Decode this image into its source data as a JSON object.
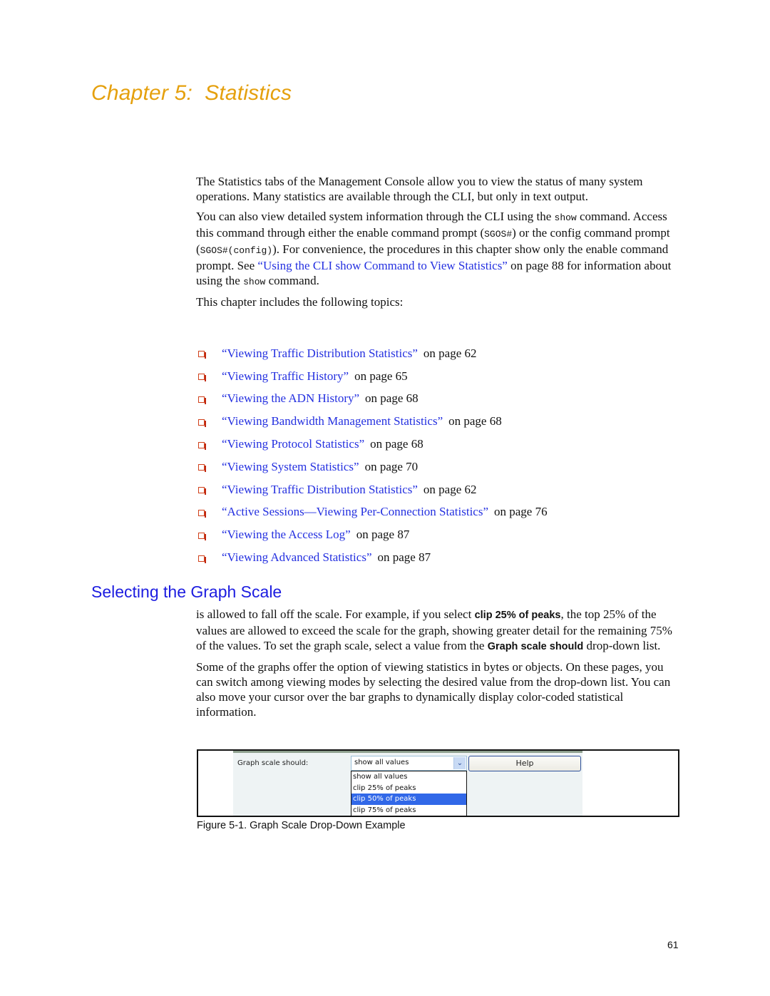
{
  "chapter": {
    "title": "Chapter 5:  Statistics"
  },
  "intro": {
    "p1": "The Statistics tabs of the Management Console allow you to view the status of many system operations. Many statistics are available through the CLI, but only in text output.",
    "p2": {
      "t1": "You can also view detailed system information through the CLI using the ",
      "code1": "show",
      "t2": " command. Access this command through either the enable command prompt (",
      "code2": "SGOS#",
      "t3": ") or the config command prompt (",
      "code3": "SGOS#(config)",
      "t4": "). For convenience, the procedures in this chapter show only the enable command prompt. See ",
      "link": "“Using the CLI show Command to View Statistics”",
      "t5": " on page 88 for information about using the ",
      "code4": "show",
      "t6": " command."
    },
    "p3": "This chapter includes the following topics:"
  },
  "topics": [
    {
      "label": "“Viewing Traffic Distribution Statistics”",
      "page": "on page 62"
    },
    {
      "label": "“Viewing Traffic History”",
      "page": "on page 65"
    },
    {
      "label": "“Viewing the ADN History”",
      "page": "on page 68"
    },
    {
      "label": "“Viewing Bandwidth Management Statistics”",
      "page": "on page 68"
    },
    {
      "label": "“Viewing Protocol Statistics”",
      "page": "on page 68"
    },
    {
      "label": "“Viewing System Statistics”",
      "page": "on page 70"
    },
    {
      "label": "“Viewing Traffic Distribution Statistics”",
      "page": "on page 62"
    },
    {
      "label": "“Active Sessions—Viewing Per-Connection Statistics”",
      "page": "on page 76"
    },
    {
      "label": "“Viewing the Access Log”",
      "page": "on page 87"
    },
    {
      "label": "“Viewing Advanced Statistics”",
      "page": "on page 87"
    }
  ],
  "section": {
    "title": "Selecting the Graph Scale",
    "p1": {
      "t1": "is allowed to fall off the scale. For example, if you select ",
      "b1": "clip 25% of peaks",
      "t2": ", the top 25% of the values are allowed to exceed the scale for the graph, showing greater detail for the remaining 75% of the values. To set the graph scale, select a value from the ",
      "b2": "Graph scale should",
      "t3": " drop-down list."
    },
    "p2": "Some of the graphs offer the option of viewing statistics in bytes or objects. On these pages, you can switch among viewing modes by selecting the desired value from the drop-down list. You can also move your cursor over the bar graphs to dynamically display color-coded statistical information."
  },
  "figure": {
    "label": "Graph scale should:",
    "selected_value": "show all values",
    "arrow_glyph": "⌄",
    "options": [
      {
        "label": "show all values",
        "highlighted": false
      },
      {
        "label": "clip 25% of peaks",
        "highlighted": false
      },
      {
        "label": "clip 50% of peaks",
        "highlighted": true
      },
      {
        "label": "clip 75% of peaks",
        "highlighted": false
      }
    ],
    "help_label": "Help",
    "caption": "Figure 5-1.  Graph Scale Drop-Down Example"
  },
  "page_number": "61"
}
